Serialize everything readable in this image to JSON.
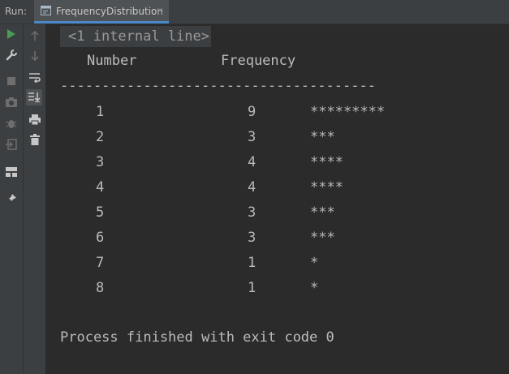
{
  "run_panel": {
    "label": "Run:",
    "tab_title": "FrequencyDistribution",
    "tab_close": "×"
  },
  "toolbar_icons": {
    "left": [
      "run-icon",
      "wrench-icon",
      "stop-icon",
      "camera-icon",
      "debug-icon",
      "login-icon",
      "layout-icon",
      "pin-icon"
    ],
    "right": [
      "arrow-up-icon",
      "arrow-down-icon",
      "soft-wrap-icon",
      "scroll-to-end-icon",
      "print-icon",
      "trash-icon"
    ]
  },
  "console": {
    "internal_line": "<1 internal line>",
    "header_number": "Number",
    "header_frequency": "Frequency",
    "separator": "--------------------------------------",
    "rows": [
      {
        "number": "1",
        "frequency": "9",
        "stars": "*********"
      },
      {
        "number": "2",
        "frequency": "3",
        "stars": "***"
      },
      {
        "number": "3",
        "frequency": "4",
        "stars": "****"
      },
      {
        "number": "4",
        "frequency": "4",
        "stars": "****"
      },
      {
        "number": "5",
        "frequency": "3",
        "stars": "***"
      },
      {
        "number": "6",
        "frequency": "3",
        "stars": "***"
      },
      {
        "number": "7",
        "frequency": "1",
        "stars": "*"
      },
      {
        "number": "8",
        "frequency": "1",
        "stars": "*"
      }
    ],
    "exit_message": "Process finished with exit code 0"
  },
  "colors": {
    "background": "#2b2b2b",
    "panel": "#3c3f41",
    "text": "#bbbbbb",
    "run_green": "#499c54",
    "tab_underline": "#4a88c7"
  }
}
